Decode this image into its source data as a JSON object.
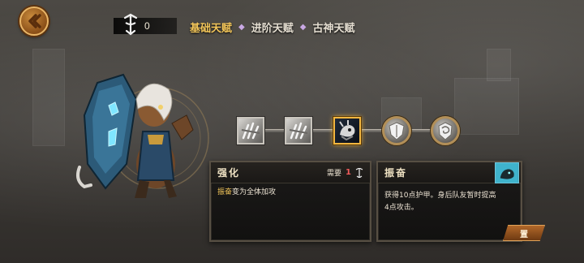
{
  "header": {
    "currency_value": "0",
    "tabs": [
      {
        "label": "基础天赋",
        "active": true
      },
      {
        "label": "进阶天赋",
        "active": false
      },
      {
        "label": "古神天赋",
        "active": false
      }
    ]
  },
  "talent_path": {
    "nodes": [
      {
        "icon": "gray-claw-icon",
        "state": "locked"
      },
      {
        "icon": "gray-claw-icon",
        "state": "locked"
      },
      {
        "icon": "dragon-head-icon",
        "state": "selected"
      },
      {
        "icon": "shield-icon",
        "state": "locked"
      },
      {
        "icon": "swirl-shield-icon",
        "state": "locked"
      }
    ]
  },
  "left_panel": {
    "title": "强化",
    "requirement_label": "需要",
    "requirement_value": "1",
    "desc_highlight": "振奋",
    "desc_rest": "变为全体加攻"
  },
  "right_panel": {
    "title": "振奋",
    "desc_line1": "获得10点护甲。身后队友暂时提高",
    "desc_line2": "4点攻击。"
  },
  "reset_button_label": "置",
  "colors": {
    "accent_gold": "#f3c65a",
    "requirement_red": "#f15b5b",
    "panel_border": "#574f43"
  }
}
